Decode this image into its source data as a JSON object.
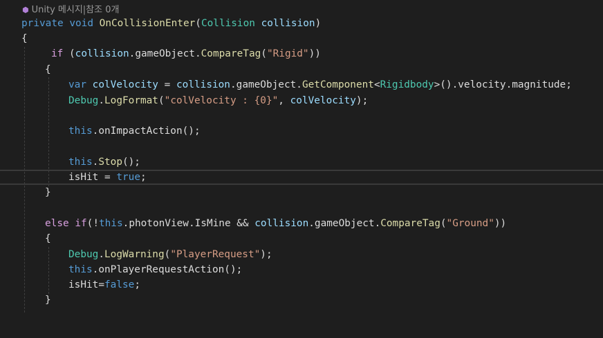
{
  "codelens": {
    "icon": "unity-cube-icon",
    "text": "Unity 메시지|참조 0개"
  },
  "code": {
    "l1": [
      "private",
      "void",
      "OnCollisionEnter",
      "(",
      "Collision",
      "collision",
      ")"
    ],
    "l2": "{",
    "l3": [
      "if",
      "(",
      "collision",
      ".",
      "gameObject",
      ".",
      "CompareTag",
      "(",
      "\"Rigid\"",
      "))"
    ],
    "l4": "{",
    "l5": [
      "var",
      "colVelocity",
      "=",
      "collision",
      ".",
      "gameObject",
      ".",
      "GetComponent",
      "<",
      "Rigidbody",
      ">",
      "().",
      "velocity",
      ".",
      "magnitude",
      ";"
    ],
    "l6": [
      "Debug",
      ".",
      "LogFormat",
      "(",
      "\"colVelocity : {0}\"",
      ", ",
      "colVelocity",
      ");"
    ],
    "l8": [
      "this",
      ".",
      "onImpactAction",
      "();"
    ],
    "l10": [
      "this",
      ".",
      "Stop",
      "();"
    ],
    "l11": [
      "isHit",
      " = ",
      "true",
      ";"
    ],
    "l12": "}",
    "l14": [
      "else if",
      "(!",
      "this",
      ".",
      "photonView",
      ".",
      "IsMine",
      " && ",
      "collision",
      ".",
      "gameObject",
      ".",
      "CompareTag",
      "(",
      "\"Ground\"",
      "))"
    ],
    "l15": "{",
    "l16": [
      "Debug",
      ".",
      "LogWarning",
      "(",
      "\"PlayerRequest\"",
      ");"
    ],
    "l17": [
      "this",
      ".",
      "onPlayerRequestAction",
      "();"
    ],
    "l18": [
      "isHit",
      "=",
      "false",
      ";"
    ],
    "l19": "}"
  }
}
